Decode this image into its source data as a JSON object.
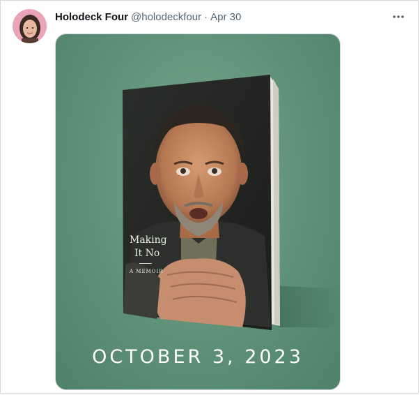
{
  "author": {
    "name": "Holodeck Four",
    "handle": "@holodeckfour",
    "separator": "·",
    "date": "Apr 30"
  },
  "icons": {
    "more": "more-horizontal-icon"
  },
  "media": {
    "book_title_line1": "Making",
    "book_title_line2": "It No",
    "book_subtitle": "A MEMOIR",
    "release_date": "OCTOBER 3, 2023"
  },
  "colors": {
    "background_green": "#5e9177",
    "text_primary": "#0f1419",
    "text_secondary": "#536471",
    "border": "#cfd9de"
  }
}
